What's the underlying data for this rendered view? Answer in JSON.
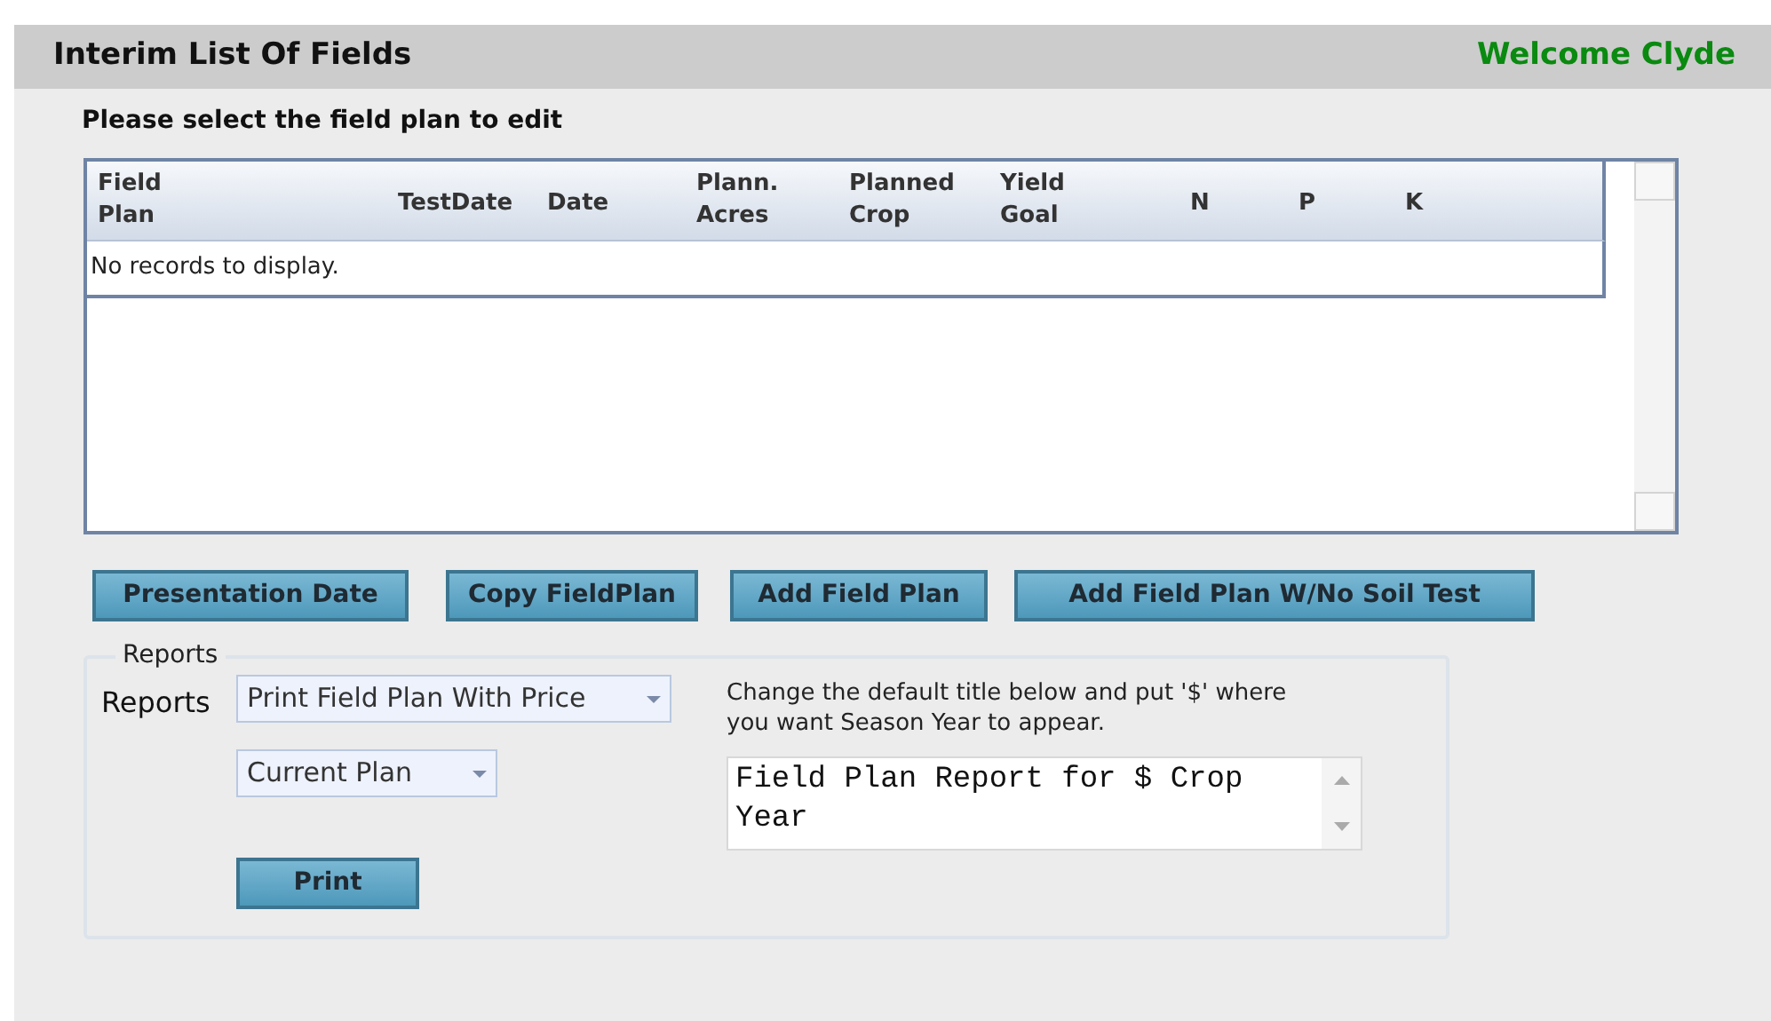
{
  "header": {
    "title": "Interim List Of Fields",
    "welcome": "Welcome Clyde"
  },
  "instruction": "Please select the field plan to edit",
  "table": {
    "columns": [
      "Field Plan",
      "TestDate",
      "Date",
      "Plann. Acres",
      "Planned Crop",
      "Yield Goal",
      "N",
      "P",
      "K"
    ],
    "empty_message": "No records to display."
  },
  "buttons": [
    "Presentation Date",
    "Copy FieldPlan",
    "Add Field Plan",
    "Add Field Plan W/No Soil Test"
  ],
  "reports": {
    "legend": "Reports",
    "label": "Reports",
    "report_select": "Print Field Plan With Price",
    "plan_select": "Current Plan",
    "print_button": "Print",
    "help": "Change the default title below and put '$' where you want Season Year to appear.",
    "title_value": "Field Plan Report for $ Crop Year"
  }
}
